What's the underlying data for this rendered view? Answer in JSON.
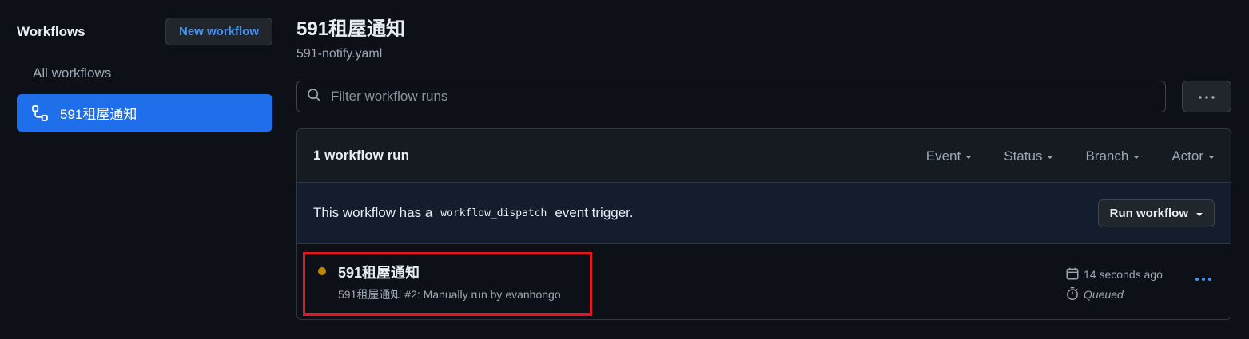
{
  "sidebar": {
    "title": "Workflows",
    "new_button": "New workflow",
    "items": [
      {
        "label": "All workflows",
        "active": false
      },
      {
        "label": "591租屋通知",
        "active": true,
        "icon": "workflow-icon"
      }
    ]
  },
  "main": {
    "title": "591租屋通知",
    "file": "591-notify.yaml",
    "filter": {
      "placeholder": "Filter workflow runs",
      "value": ""
    },
    "more_icon": "kebab-horizontal-icon",
    "panel": {
      "count": "1 workflow run",
      "filters": [
        "Event",
        "Status",
        "Branch",
        "Actor"
      ],
      "dispatch": {
        "prefix": "This workflow has a",
        "code": "workflow_dispatch",
        "suffix": "event trigger.",
        "button": "Run workflow"
      },
      "runs": [
        {
          "title": "591租屋通知",
          "subtitle": "591租屋通知 #2: Manually run by evanhongo",
          "time": "14 seconds ago",
          "status": "Queued",
          "status_color": "#bf8700"
        }
      ]
    }
  },
  "colors": {
    "background": "#0d1117",
    "accent": "#1f6feb",
    "link": "#4493f8",
    "highlight_border": "#e5161d"
  }
}
